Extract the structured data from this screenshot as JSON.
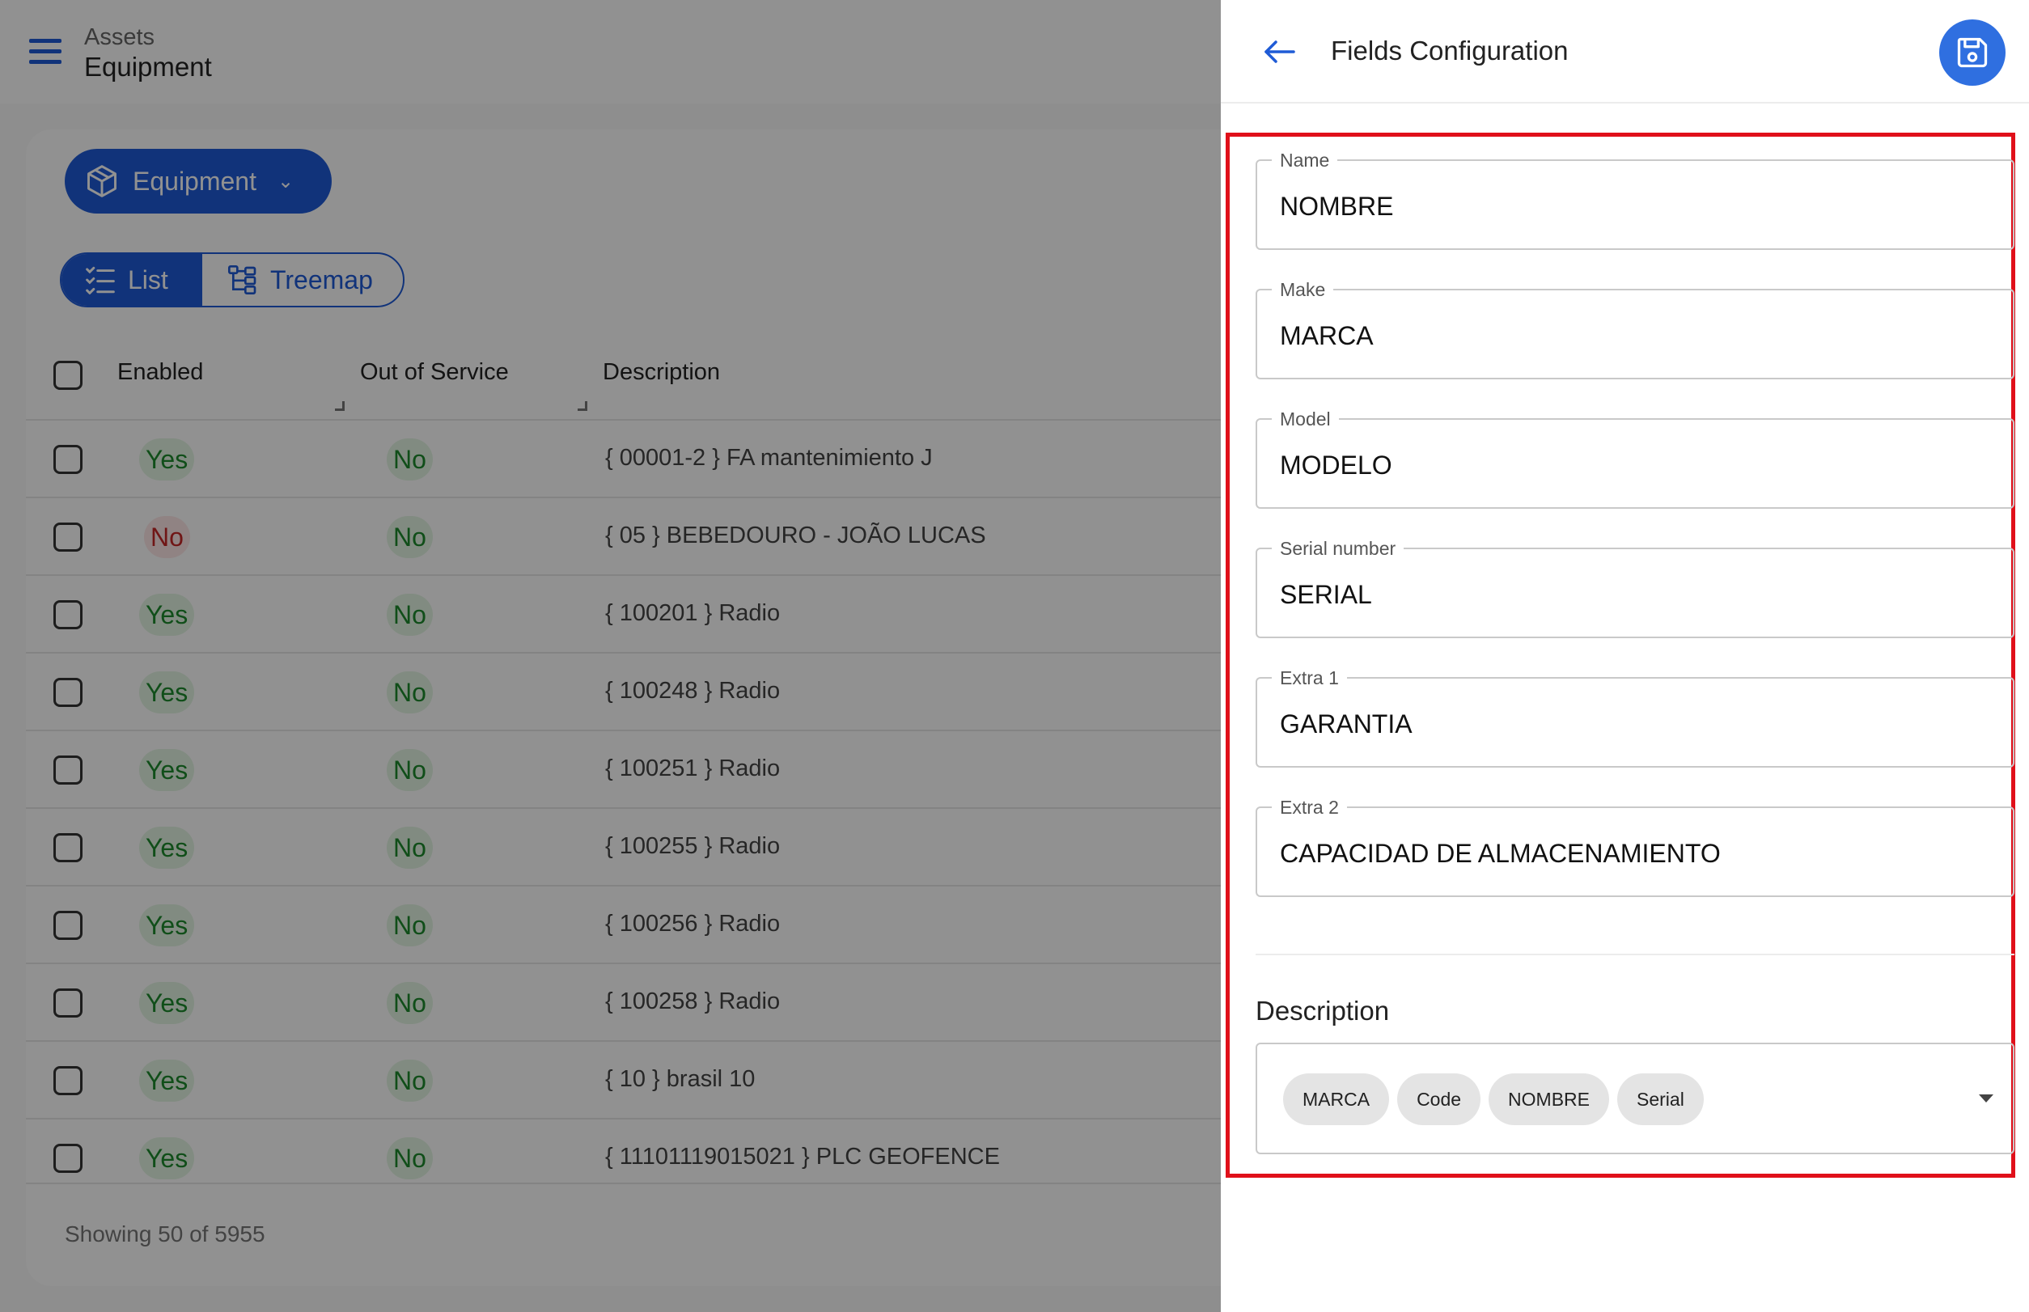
{
  "header": {
    "breadcrumb_parent": "Assets",
    "breadcrumb_current": "Equipment"
  },
  "toolbar": {
    "equipment_button": "Equipment",
    "view_list": "List",
    "view_treemap": "Treemap"
  },
  "table": {
    "columns": [
      "Enabled",
      "Out of Service",
      "Description"
    ],
    "rows": [
      {
        "enabled": "Yes",
        "out_of_service": "No",
        "description": "{ 00001-2 } FA mantenimiento J"
      },
      {
        "enabled": "No",
        "out_of_service": "No",
        "description": "{ 05 } BEBEDOURO - JOÃO LUCAS"
      },
      {
        "enabled": "Yes",
        "out_of_service": "No",
        "description": "{ 100201 } Radio"
      },
      {
        "enabled": "Yes",
        "out_of_service": "No",
        "description": "{ 100248 } Radio"
      },
      {
        "enabled": "Yes",
        "out_of_service": "No",
        "description": "{ 100251 } Radio"
      },
      {
        "enabled": "Yes",
        "out_of_service": "No",
        "description": "{ 100255 } Radio"
      },
      {
        "enabled": "Yes",
        "out_of_service": "No",
        "description": "{ 100256 } Radio"
      },
      {
        "enabled": "Yes",
        "out_of_service": "No",
        "description": "{ 100258 } Radio"
      },
      {
        "enabled": "Yes",
        "out_of_service": "No",
        "description": "{ 10 } brasil 10"
      },
      {
        "enabled": "Yes",
        "out_of_service": "No",
        "description": "{ 11101119015021 } PLC GEOFENCE"
      }
    ],
    "footer": "Showing 50 of 5955"
  },
  "panel": {
    "title": "Fields Configuration",
    "fields": [
      {
        "label": "Name",
        "value": "NOMBRE"
      },
      {
        "label": "Make",
        "value": "MARCA"
      },
      {
        "label": "Model",
        "value": "MODELO"
      },
      {
        "label": "Serial number",
        "value": "SERIAL"
      },
      {
        "label": "Extra 1",
        "value": "GARANTIA"
      },
      {
        "label": "Extra 2",
        "value": "CAPACIDAD DE ALMACENAMIENTO"
      }
    ],
    "description_label": "Description",
    "description_chips": [
      "MARCA",
      "Code",
      "NOMBRE",
      "Serial"
    ]
  },
  "colors": {
    "primary": "#1f5bd6",
    "save_button": "#2f6fe0",
    "highlight_border": "#e0101a",
    "yes_text": "#1d8a2d",
    "no_red_text": "#c62828"
  },
  "icons": {
    "menu": "hamburger-menu-icon",
    "equipment": "box-icon",
    "list": "checklist-icon",
    "treemap": "tree-icon",
    "back": "arrow-left-icon",
    "save": "floppy-disk-icon"
  }
}
